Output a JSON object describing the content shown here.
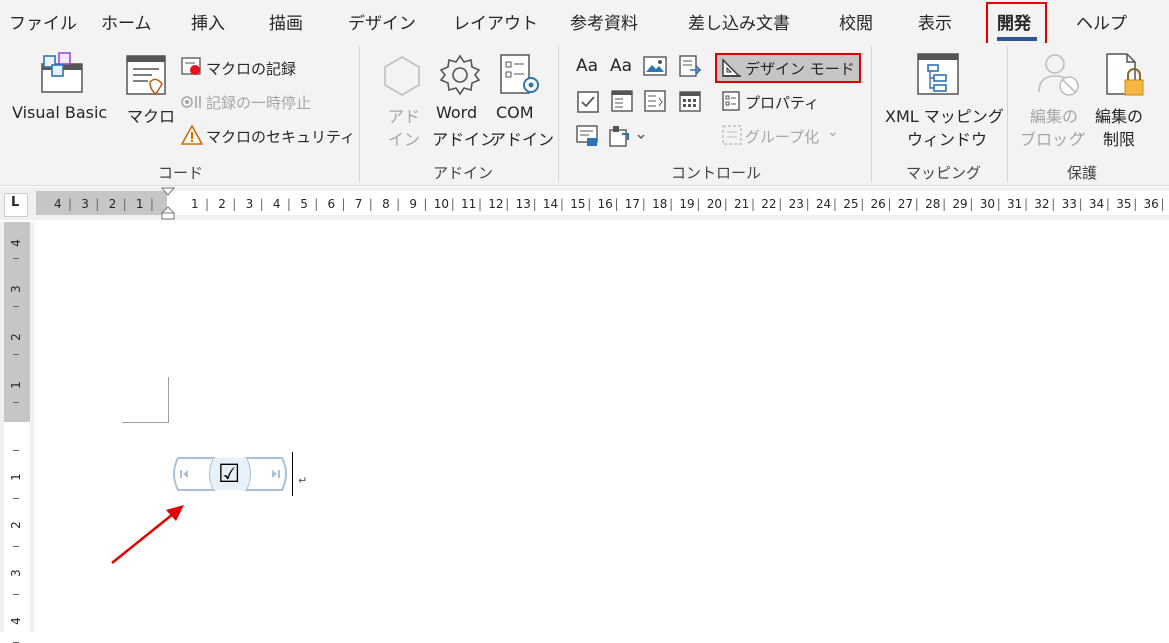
{
  "tabs": [
    "ファイル",
    "ホーム",
    "挿入",
    "描画",
    "デザイン",
    "レイアウト",
    "参考資料",
    "差し込み文書",
    "校閲",
    "表示",
    "開発",
    "ヘルプ"
  ],
  "active_tab": "開発",
  "code_group": {
    "visual_basic": "Visual Basic",
    "macro": "マクロ",
    "record_macro": "マクロの記録",
    "pause_recording": "記録の一時停止",
    "macro_security": "マクロのセキュリティ",
    "label": "コード"
  },
  "addin_group": {
    "addin_line1": "アド",
    "addin_line2": "イン",
    "word_line1": "Word",
    "word_line2": "アドイン",
    "com_line1": "COM",
    "com_line2": "アドイン",
    "label": "アドイン"
  },
  "controls_group": {
    "design_mode": "デザイン モード",
    "properties": "プロパティ",
    "group": "グループ化",
    "label": "コントロール"
  },
  "mapping_group": {
    "xml_line1": "XML マッピング",
    "xml_line2": "ウィンドウ",
    "label": "マッピング"
  },
  "protect_group": {
    "block_line1": "編集の",
    "block_line2": "ブロック",
    "restrict_line1": "編集の",
    "restrict_line2": "制限",
    "label": "保護"
  },
  "ruler": {
    "left_numbers": [
      "4",
      "3",
      "2",
      "1"
    ],
    "right_numbers": [
      "1",
      "2",
      "3",
      "4",
      "5",
      "6",
      "7",
      "8",
      "9",
      "10",
      "11",
      "12",
      "13",
      "14",
      "15",
      "16",
      "17",
      "18",
      "19",
      "20",
      "21",
      "22",
      "23",
      "24",
      "25",
      "26",
      "27",
      "28",
      "29",
      "30",
      "31",
      "32",
      "33",
      "34",
      "35",
      "36"
    ],
    "vertical_numbers": [
      "4",
      "3",
      "2",
      "1",
      "1",
      "2",
      "3",
      "4"
    ],
    "tab_selector": "L"
  },
  "document": {
    "checkbox_symbol": "☑",
    "paragraph_mark": "↵"
  },
  "colors": {
    "highlight_red": "#e00000",
    "design_mode_bg": "#c5c5c5",
    "tab_underline": "#2b579a",
    "ruler_gray": "#c6c6c6"
  }
}
